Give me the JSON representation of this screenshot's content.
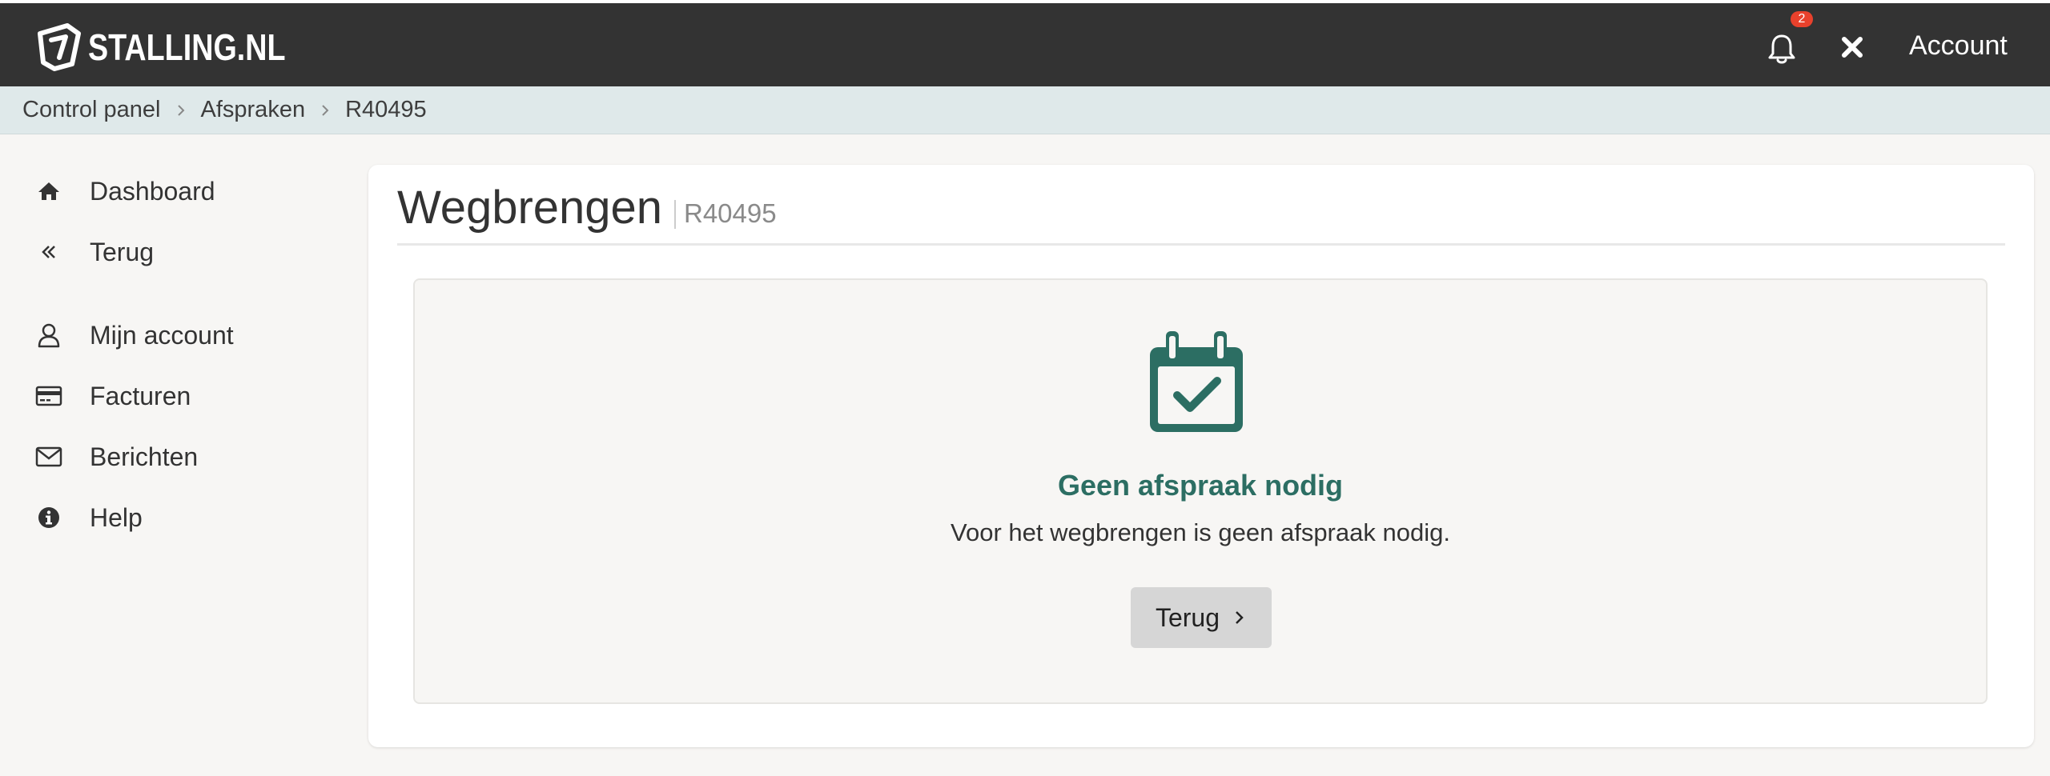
{
  "header": {
    "logo_text": "STALLING.NL",
    "notification_count": "2",
    "account_label": "Account",
    "icons": [
      "logo-icon",
      "bell-icon",
      "close-icon"
    ],
    "background": "#333333"
  },
  "breadcrumb": {
    "items": [
      "Control panel",
      "Afspraken",
      "R40495"
    ]
  },
  "sidebar": {
    "items": [
      {
        "label": "Dashboard",
        "icon": "home-icon"
      },
      {
        "label": "Terug",
        "icon": "double-chevron-left-icon"
      },
      {
        "label": "Mijn account",
        "icon": "user-icon"
      },
      {
        "label": "Facturen",
        "icon": "credit-card-icon"
      },
      {
        "label": "Berichten",
        "icon": "envelope-icon"
      },
      {
        "label": "Help",
        "icon": "info-circle-icon"
      }
    ]
  },
  "main": {
    "title": "Wegbrengen",
    "reference": "R40495",
    "notice": {
      "icon": "calendar-check-icon",
      "title": "Geen afspraak nodig",
      "text": "Voor het wegbrengen is geen afspraak nodig.",
      "button_label": "Terug"
    }
  },
  "colors": {
    "accent": "#2c6e63",
    "badge": "#e8412c",
    "breadcrumb_bg": "#dfe9ea",
    "button_bg": "#d6d6d6"
  }
}
